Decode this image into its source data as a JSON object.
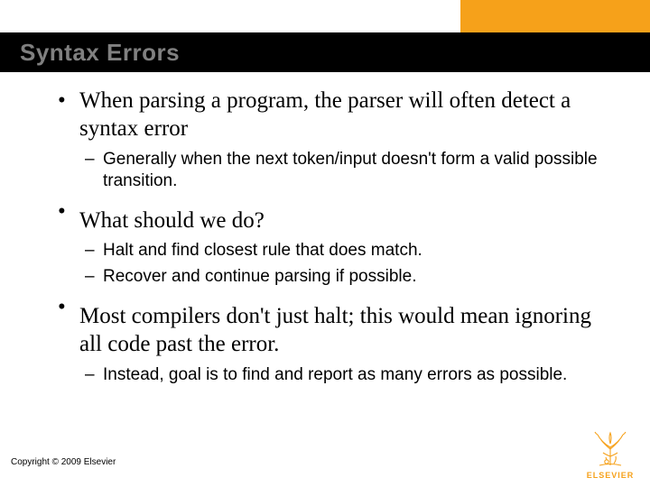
{
  "title": "Syntax Errors",
  "bullets": {
    "b1": {
      "text": "When parsing a program, the parser will often detect a syntax error",
      "sub": {
        "s1": "Generally when the next token/input doesn't form a valid possible transition."
      }
    },
    "b2": {
      "text": "What should we do?",
      "sub": {
        "s1": "Halt and find closest rule that does match.",
        "s2": "Recover and continue parsing if possible."
      }
    },
    "b3": {
      "text": "Most compilers don't just halt; this would mean ignoring all code past the error.",
      "sub": {
        "s1": "Instead, goal is to find and report as many errors as possible."
      }
    }
  },
  "footer": {
    "copyright": "Copyright © 2009 Elsevier",
    "publisher": "ELSEVIER"
  },
  "colors": {
    "accent": "#f6a11a",
    "title_gray": "#808080"
  }
}
